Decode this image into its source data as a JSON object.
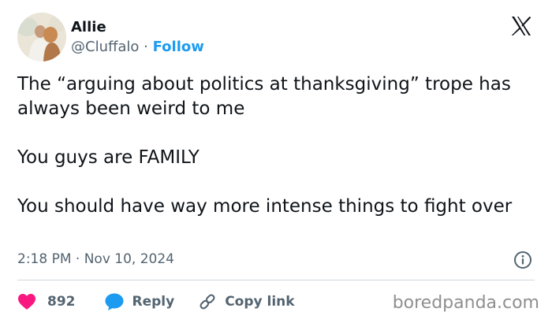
{
  "author": {
    "display_name": "Allie",
    "handle": "@Cluffalo",
    "separator": " · ",
    "follow_label": "Follow"
  },
  "tweet": {
    "paragraphs": [
      "The “arguing about politics at thanksgiving” trope has always been weird to me",
      "You guys are FAMILY",
      "You should have way more intense things to fight over"
    ],
    "timestamp": "2:18 PM · Nov 10, 2024"
  },
  "actions": {
    "like_count": "892",
    "reply_label": "Reply",
    "copy_link_label": "Copy link"
  },
  "watermark": "boredpanda.com",
  "icons": {
    "brand": "x-logo-icon",
    "info": "info-icon",
    "like": "heart-icon",
    "reply": "reply-bubble-icon",
    "copy_link": "link-icon"
  },
  "colors": {
    "text": "#0f1419",
    "secondary": "#536471",
    "accent": "#1d9bf0",
    "like": "#f91880",
    "divider": "#cfd9de"
  }
}
